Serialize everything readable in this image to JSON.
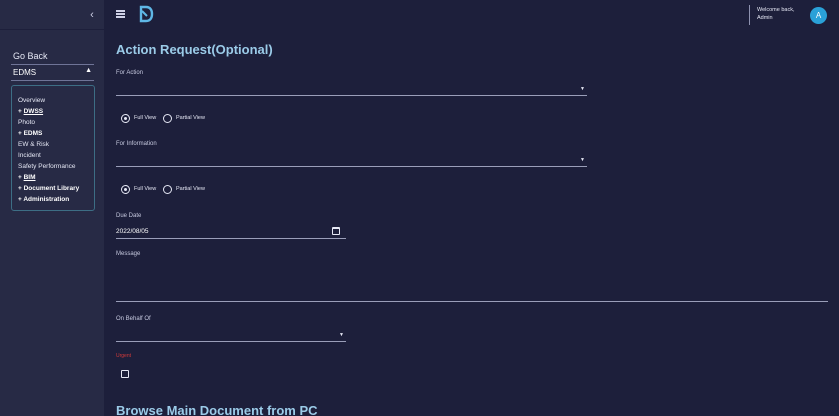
{
  "sidebar": {
    "go_back": "Go Back",
    "section": "EDMS",
    "items": [
      {
        "label": "Overview"
      },
      {
        "label": "+ DWSS"
      },
      {
        "label": "Photo"
      },
      {
        "label": "+ EDMS"
      },
      {
        "label": "EW & Risk"
      },
      {
        "label": "Incident"
      },
      {
        "label": "Safety Performance"
      },
      {
        "label": "+ BIM"
      },
      {
        "label": "+ Document Library"
      },
      {
        "label": "+ Administration"
      }
    ]
  },
  "header": {
    "welcome_line1": "Welcome back,",
    "welcome_line2": "Admin",
    "avatar_initial": "A"
  },
  "form": {
    "title": "Action Request(Optional)",
    "for_action": {
      "label": "For Action",
      "value": ""
    },
    "view_options_1": {
      "full": "Full View",
      "partial": "Partial View",
      "selected": "Full View"
    },
    "for_information": {
      "label": "For Information",
      "value": ""
    },
    "view_options_2": {
      "full": "Full View",
      "partial": "Partial View",
      "selected": "Full View"
    },
    "due_date": {
      "label": "Due Date",
      "value": "2022/08/05"
    },
    "message": {
      "label": "Message",
      "value": ""
    },
    "on_behalf_of": {
      "label": "On Behalf Of",
      "value": ""
    },
    "urgent": {
      "label": "Urgent",
      "checked": false
    },
    "browse_title": "Browse Main Document from PC"
  },
  "colors": {
    "background": "#1d1f3b",
    "sidebar": "#272a45",
    "title": "#9bcbe8",
    "avatar": "#2aa1d8",
    "urgent": "#d33a3a"
  },
  "icons": {
    "collapse": "chevron-left-icon",
    "menu": "hamburger-icon",
    "logo": "logo-icon",
    "calendar": "calendar-icon",
    "dropdown": "caret-down-icon"
  }
}
